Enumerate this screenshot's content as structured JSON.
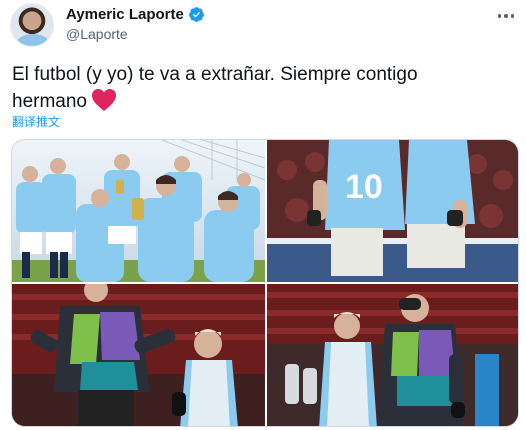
{
  "author": {
    "display_name": "Aymeric Laporte",
    "handle": "@Laporte",
    "verified": true
  },
  "tweet": {
    "text_line1": "El futbol (y yo) te va a extrañar. Siempre contigo",
    "text_line2": "hermano",
    "emoji": "red-heart",
    "translate_label": "翻译推文"
  },
  "media": {
    "photo_count": 4,
    "photos": [
      {
        "description": "celebration"
      },
      {
        "description": "jersey-10"
      },
      {
        "description": "training-warmup"
      },
      {
        "description": "training-facepalm"
      }
    ]
  },
  "colors": {
    "accent": "#1d9bf0",
    "heart": "#e0245e",
    "sky_blue_kit": "#8ccbf0"
  }
}
